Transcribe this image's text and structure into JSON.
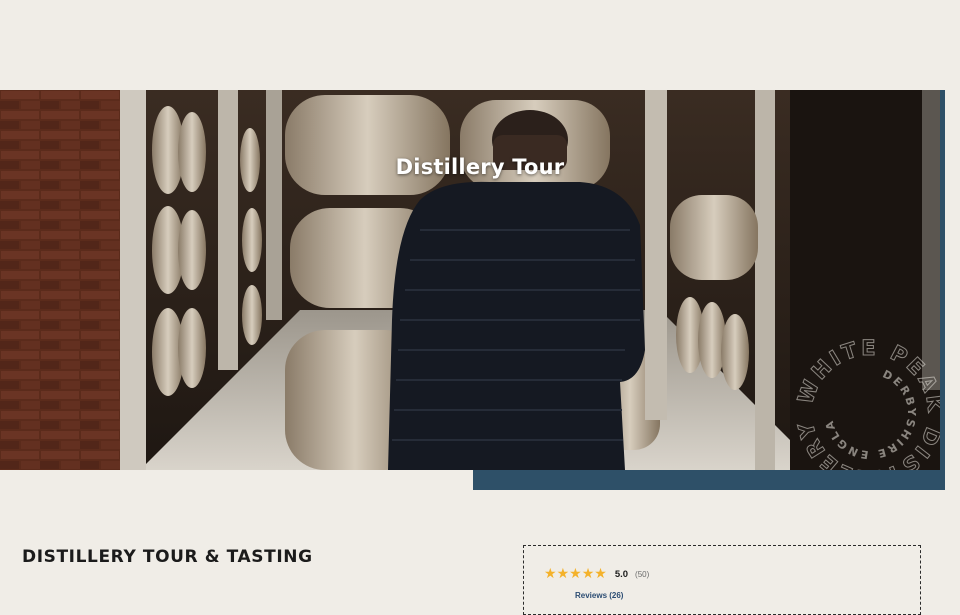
{
  "hero": {
    "title": "Distillery Tour",
    "stamp_outer_text": "WHITE PEAK DISTILLERY",
    "stamp_inner_text": "DERBYSHIRE ENGLAND"
  },
  "product": {
    "title": "DISTILLERY TOUR & TASTING"
  },
  "reviews": {
    "rating": "5.0",
    "rating_count": "(50)",
    "reviews_link": "Reviews (26)",
    "stars": 5
  },
  "colors": {
    "background": "#f0ede7",
    "accent_blue": "#2e5068",
    "star": "#f4b22b",
    "link": "#2c4d73"
  }
}
